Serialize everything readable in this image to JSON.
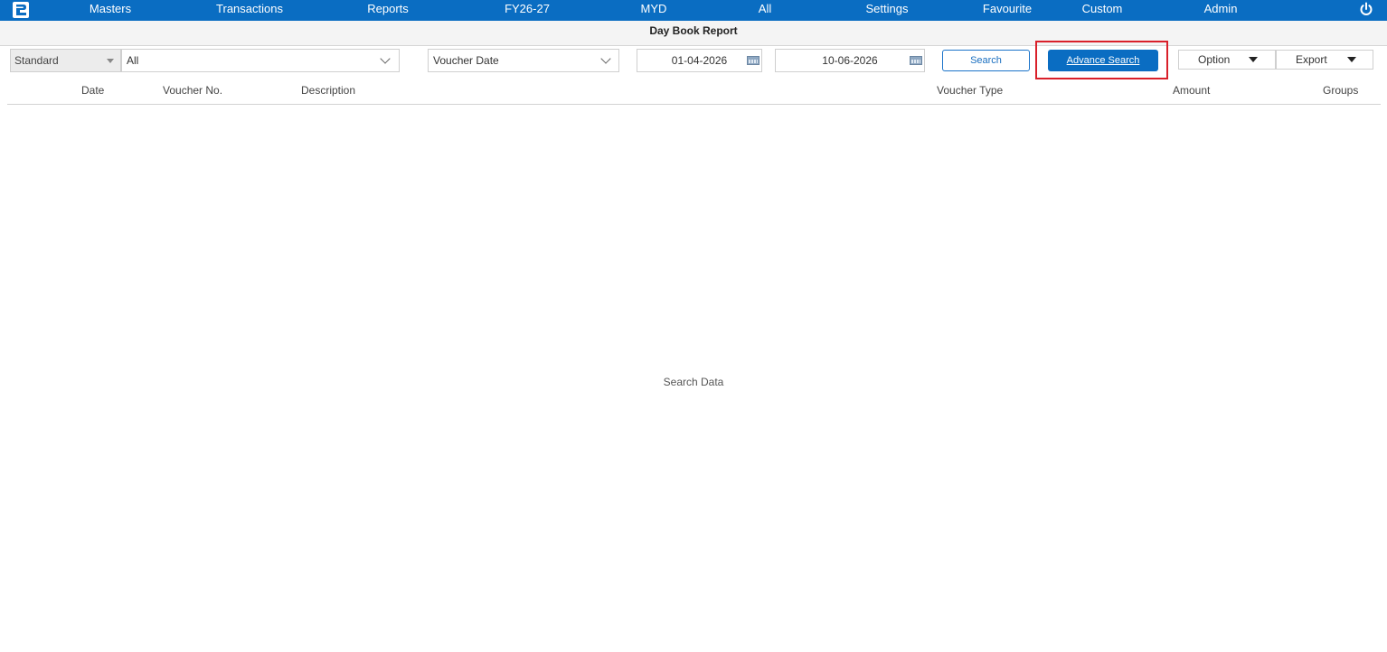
{
  "nav": {
    "items": [
      {
        "label": "Masters"
      },
      {
        "label": "Transactions"
      },
      {
        "label": "Reports"
      },
      {
        "label": "FY26-27"
      },
      {
        "label": "MYD"
      },
      {
        "label": "All"
      },
      {
        "label": "Settings"
      },
      {
        "label": "Favourite"
      },
      {
        "label": "Custom"
      },
      {
        "label": "Admin"
      }
    ]
  },
  "page": {
    "title": "Day Book Report"
  },
  "toolbar": {
    "report_format": "Standard",
    "filter_value": "All",
    "date_field": "Voucher Date",
    "from_date": "01-04-2026",
    "to_date": "10-06-2026",
    "search_label": "Search",
    "advance_search_label": "Advance Search",
    "option_label": "Option",
    "export_label": "Export"
  },
  "table": {
    "columns": [
      "Date",
      "Voucher No.",
      "Description",
      "Voucher Type",
      "Amount",
      "Groups"
    ],
    "empty_message": "Search Data"
  },
  "colors": {
    "accent": "#0a6dc2",
    "highlight": "#d9202a"
  }
}
